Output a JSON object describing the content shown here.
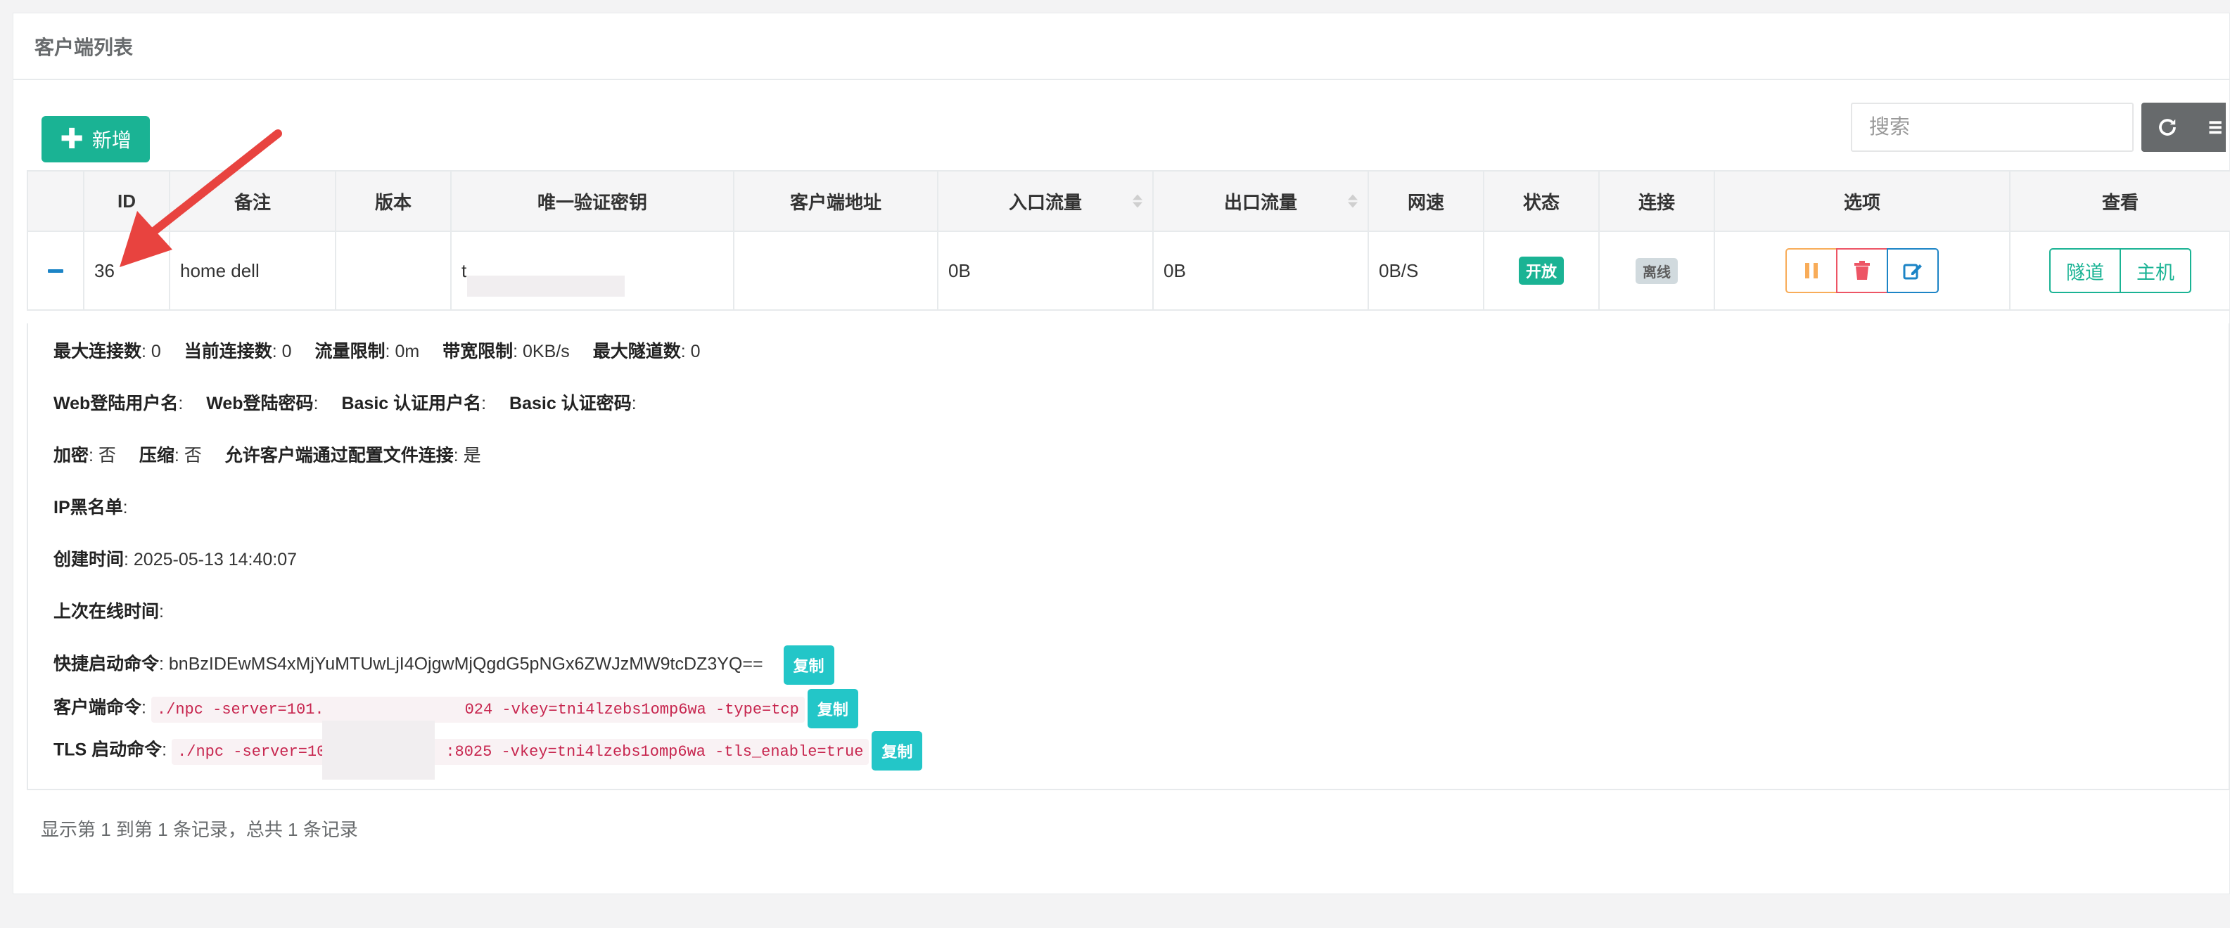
{
  "panel": {
    "title": "客户端列表"
  },
  "toolbar": {
    "add_label": "新增",
    "add_icon": "plus-icon",
    "search_placeholder": "搜索",
    "refresh_icon": "refresh-icon",
    "columns_icon": "list-icon"
  },
  "table": {
    "headers": {
      "id": "ID",
      "remark": "备注",
      "version": "版本",
      "vkey": "唯一验证密钥",
      "addr": "客户端地址",
      "in_flow": "入口流量",
      "out_flow": "出口流量",
      "speed": "网速",
      "status": "状态",
      "connect": "连接",
      "options": "选项",
      "view": "查看"
    },
    "row": {
      "id": "36",
      "remark": "home dell",
      "version": "",
      "vkey": "t",
      "addr": "",
      "in_flow": "0B",
      "out_flow": "0B",
      "speed": "0B/S",
      "status": "开放",
      "connect": "离线",
      "view_tunnel": "隧道",
      "view_host": "主机"
    }
  },
  "detail": {
    "max_conn_label": "最大连接数",
    "max_conn": ": 0",
    "cur_conn_label": "当前连接数",
    "cur_conn": ": 0",
    "flow_limit_label": "流量限制",
    "flow_limit": ": 0m",
    "rate_limit_label": "带宽限制",
    "rate_limit": ": 0KB/s",
    "max_tunnel_label": "最大隧道数",
    "max_tunnel": ": 0",
    "web_user_label": "Web登陆用户名",
    "web_pass_label": "Web登陆密码",
    "basic_user_label": "Basic 认证用户名",
    "basic_pass_label": "Basic 认证密码",
    "encrypt_label": "加密",
    "encrypt": ": 否",
    "compress_label": "压缩",
    "compress": ": 否",
    "allow_config_label": "允许客户端通过配置文件连接",
    "allow_config": ": 是",
    "ip_black_label": "IP黑名单",
    "created_label": "创建时间",
    "created": ": 2025-05-13 14:40:07",
    "last_online_label": "上次在线时间",
    "quick_cmd_label": "快捷启动命令",
    "quick_cmd": ": bnBzIDEwMS4xMjYuMTUwLjI4OjgwMjQgdG5pNGx6ZWJzMW9tcDZ3YQ==",
    "client_cmd_label": "客户端命令",
    "client_cmd_a": "./npc -server=101.",
    "client_cmd_b": "024 -vkey=tni4lzebs1omp6wa -type=tcp",
    "tls_cmd_label": "TLS 启动命令",
    "tls_cmd_a": "./npc -server=10",
    "tls_cmd_b": ":8025 -vkey=tni4lzebs1omp6wa -tls_enable=true",
    "copy_label": "复制"
  },
  "footer": {
    "summary": "显示第 1 到第 1 条记录，总共 1 条记录"
  },
  "colors": {
    "primary": "#1ab394",
    "info": "#23c6c8",
    "warning": "#f8ac59",
    "danger": "#ed5565",
    "edit": "#1c84c6",
    "annotation_arrow": "#e8433f"
  }
}
